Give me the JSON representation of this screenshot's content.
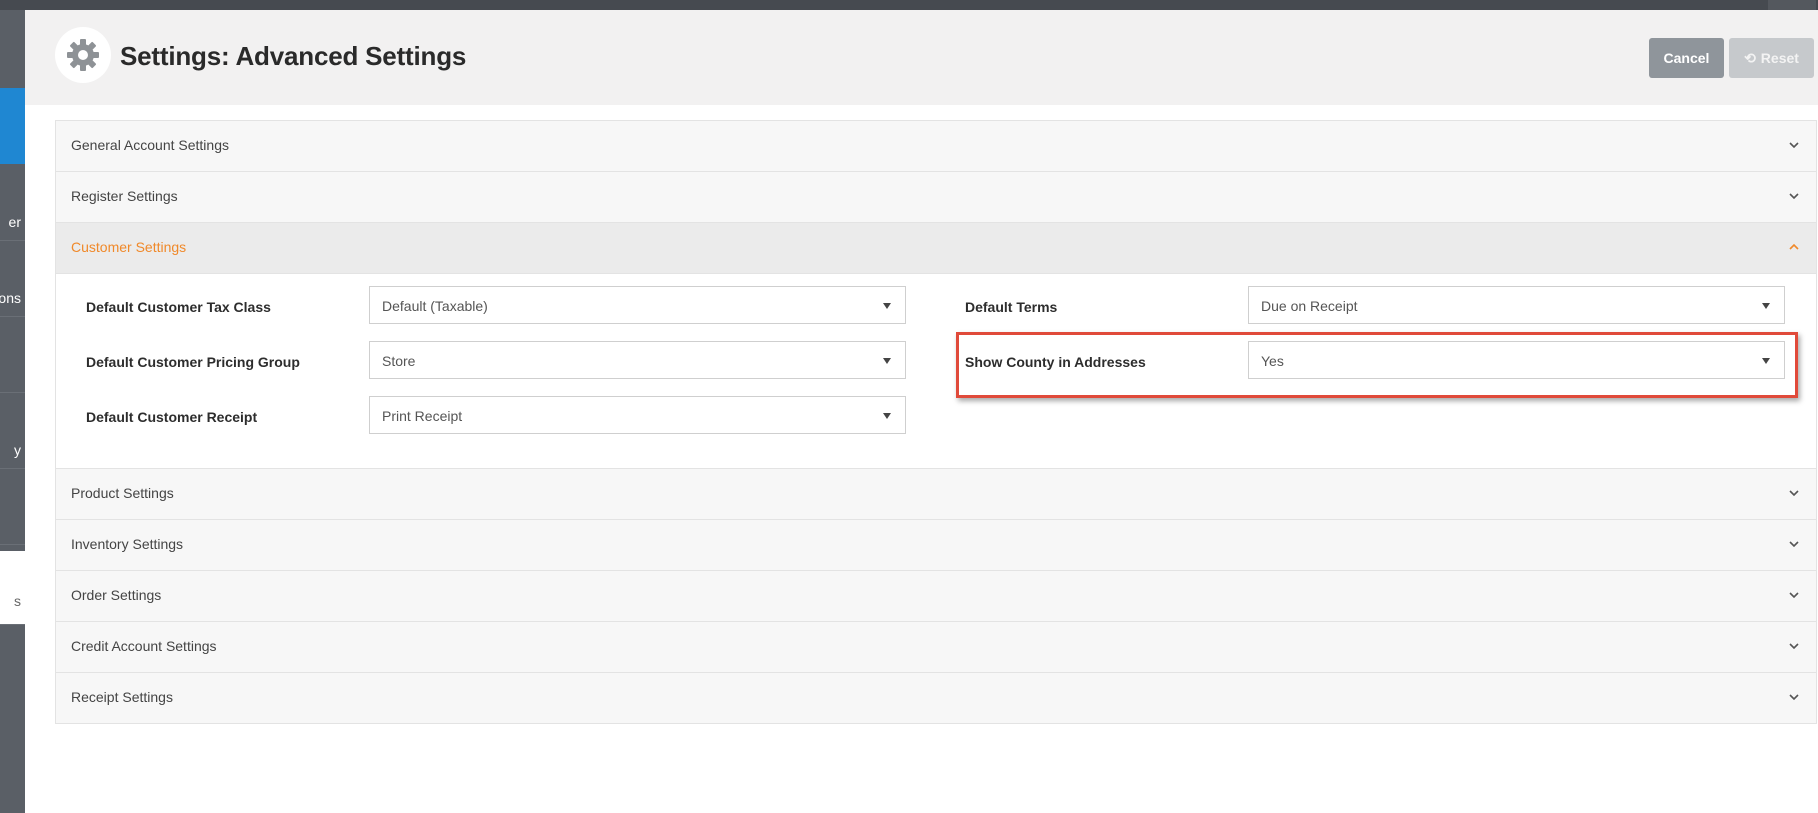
{
  "sidebar": {
    "items": [
      {
        "label": ""
      },
      {
        "label": "er"
      },
      {
        "label": "ons"
      },
      {
        "label": ""
      },
      {
        "label": "y"
      },
      {
        "label": ""
      },
      {
        "label": "s"
      }
    ]
  },
  "header": {
    "title": "Settings: Advanced Settings",
    "icon": "gear-icon",
    "cancel_label": "Cancel",
    "reset_label": "Reset"
  },
  "accordion": {
    "sections": [
      {
        "label": "General Account Settings",
        "expanded": false
      },
      {
        "label": "Register Settings",
        "expanded": false
      },
      {
        "label": "Customer Settings",
        "expanded": true
      },
      {
        "label": "Product Settings",
        "expanded": false
      },
      {
        "label": "Inventory Settings",
        "expanded": false
      },
      {
        "label": "Order Settings",
        "expanded": false
      },
      {
        "label": "Credit Account Settings",
        "expanded": false
      },
      {
        "label": "Receipt Settings",
        "expanded": false
      }
    ]
  },
  "customer_settings": {
    "tax_class": {
      "label": "Default Customer Tax Class",
      "value": "Default (Taxable)"
    },
    "pricing_group": {
      "label": "Default Customer Pricing Group",
      "value": "Store"
    },
    "receipt": {
      "label": "Default Customer Receipt",
      "value": "Print Receipt"
    },
    "terms": {
      "label": "Default Terms",
      "value": "Due on Receipt"
    },
    "show_county": {
      "label": "Show County in Addresses",
      "value": "Yes"
    }
  },
  "colors": {
    "accent_orange": "#f0892a",
    "sidebar_active": "#1f87d2",
    "highlight_red": "#e04a3a"
  }
}
